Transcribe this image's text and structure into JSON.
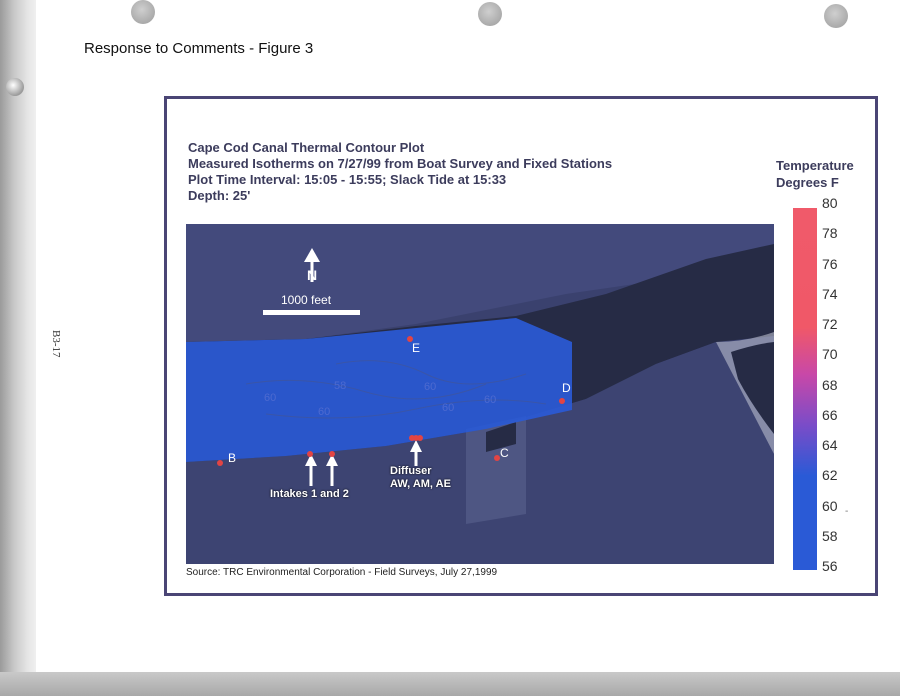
{
  "page": {
    "caption": "Response to Comments - Figure 3",
    "side_page_number": "B3-17"
  },
  "figure": {
    "title_lines": [
      "Cape Cod Canal Thermal Contour Plot",
      "Measured Isotherms on 7/27/99 from Boat Survey and Fixed Stations",
      "Plot Time Interval: 15:05 - 15:55; Slack Tide at 15:33",
      "Depth:  25'"
    ],
    "source": "Source: TRC Environmental Corporation - Field Surveys, July 27,1999",
    "colors": {
      "frame": "#4a4575",
      "title_text": "#3c3c5c",
      "isotherm_fill": "#2a5ad6",
      "station_marker": "#e24444",
      "water": "#262b45",
      "land": "#3a416e"
    }
  },
  "map": {
    "north_arrow_icon": "north-arrow-icon",
    "scale_bar_label": "1000 feet",
    "stations": [
      {
        "id": "E",
        "label": "E"
      },
      {
        "id": "D",
        "label": "D"
      },
      {
        "id": "B",
        "label": "B"
      },
      {
        "id": "C",
        "label": "C"
      }
    ],
    "isotherm_labels": [
      "58",
      "60",
      "60",
      "60",
      "60",
      "60"
    ],
    "annotations": {
      "intakes": "Intakes 1 and 2",
      "diffuser_line1": "Diffuser",
      "diffuser_line2": "AW, AM, AE"
    }
  },
  "legend": {
    "title_line1": "Temperature",
    "title_line2": "Degrees F",
    "ticks": [
      "80",
      "78",
      "76",
      "74",
      "72",
      "70",
      "68",
      "66",
      "64",
      "62",
      "60",
      "58",
      "56"
    ],
    "range": [
      56,
      80
    ],
    "colors": {
      "top": "#f05a6a",
      "upper": "#f05868",
      "mid": "#c848a8",
      "lower_mid": "#7a4cc8",
      "bottom": "#2a5ad6"
    }
  },
  "stray_mark": "-"
}
